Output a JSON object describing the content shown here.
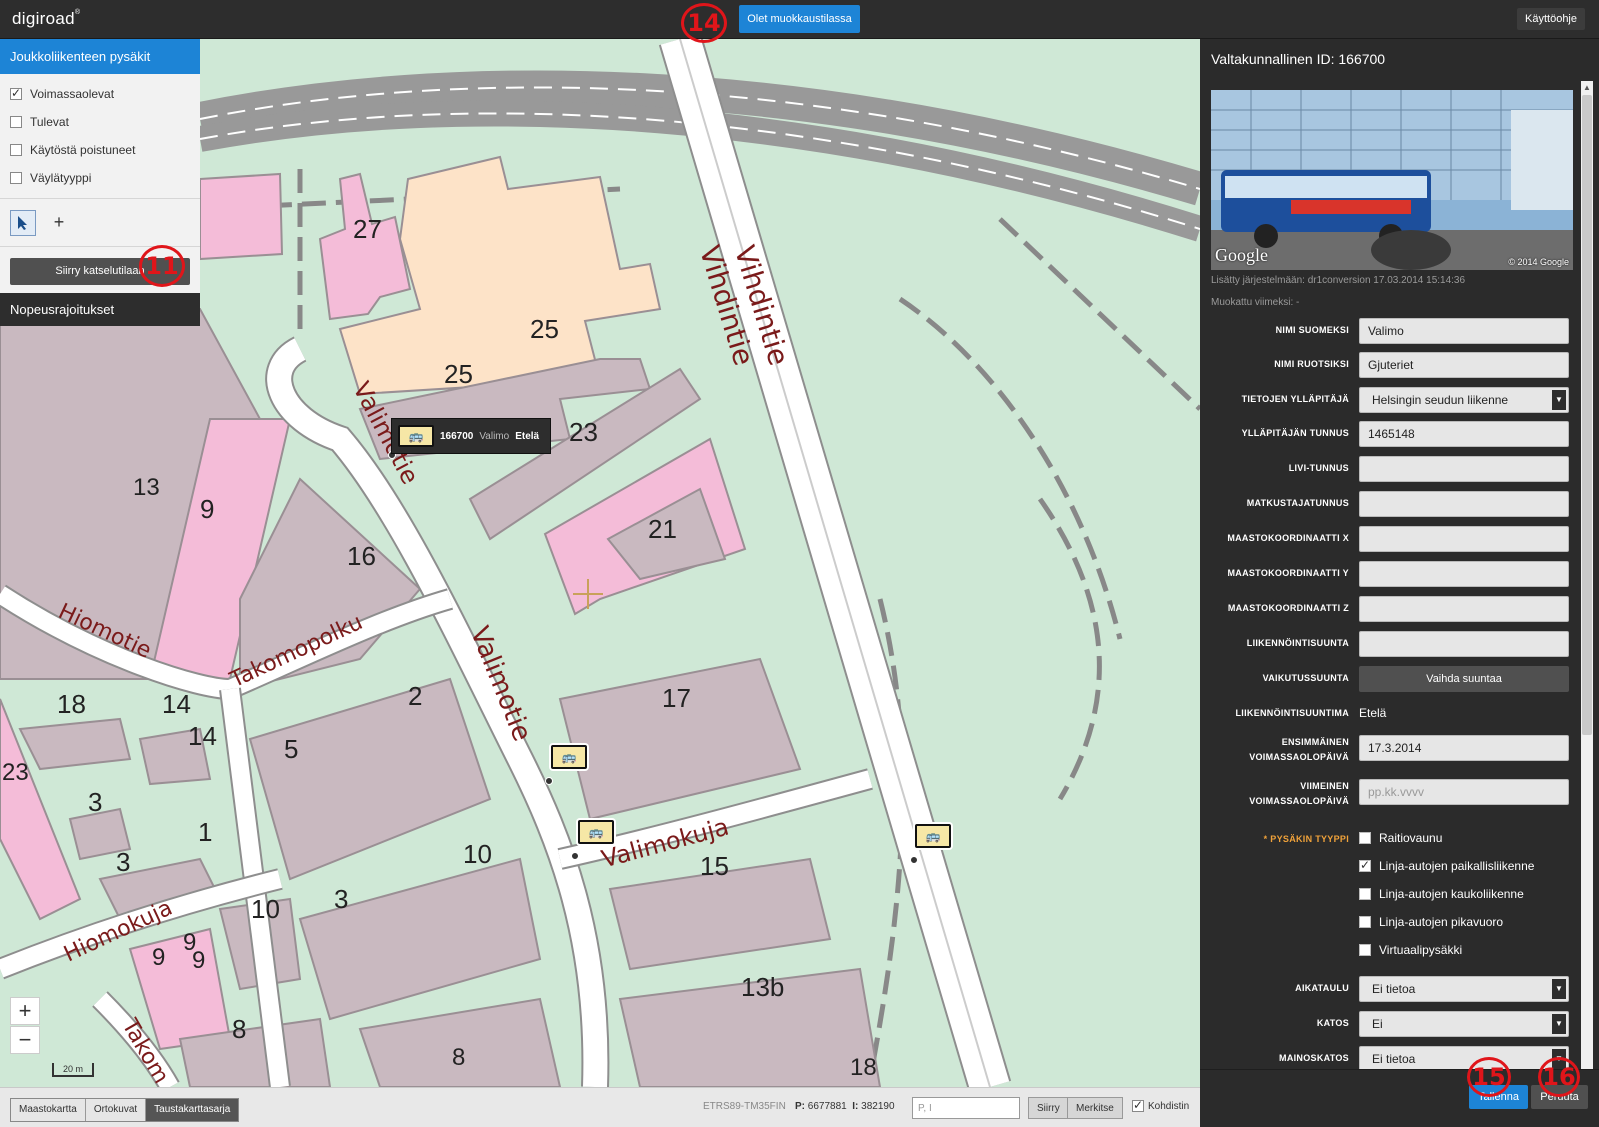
{
  "app": {
    "logo": "digiroad",
    "logo_mark": "®",
    "edit_mode_label": "Olet muokkaustilassa",
    "help_label": "Käyttöohje"
  },
  "callouts": [
    "14",
    "11",
    "15",
    "16"
  ],
  "left_panel": {
    "layer_title": "Joukkoliikenteen pysäkit",
    "layers": [
      {
        "label": "Voimassaolevat",
        "checked": true
      },
      {
        "label": "Tulevat",
        "checked": false
      },
      {
        "label": "Käytöstä poistuneet",
        "checked": false
      },
      {
        "label": "Väylätyyppi",
        "checked": false
      }
    ],
    "view_mode_button": "Siirry katselutilaan",
    "speed_limits_title": "Nopeusrajoitukset"
  },
  "map": {
    "streets": [
      "Vihdintie",
      "Vihdintie",
      "Valimotie",
      "Valimotie",
      "Hiomotie",
      "Takomopolku",
      "Valimokuja",
      "Hiomokuja",
      "Takom"
    ],
    "house_numbers": [
      "27",
      "25",
      "25",
      "23",
      "21",
      "13",
      "9",
      "16",
      "17",
      "18",
      "14",
      "14",
      "5",
      "2",
      "23",
      "3",
      "1",
      "3",
      "10",
      "15",
      "3",
      "10",
      "9",
      "9",
      "9",
      "13b",
      "8",
      "8",
      "18"
    ],
    "popup": {
      "stop_id": "166700",
      "name": "Valimo",
      "direction": "Etelä"
    },
    "zoom_in": "+",
    "zoom_out": "−",
    "scale_label": "20 m"
  },
  "bottom_bar": {
    "basemaps": [
      {
        "label": "Maastokartta",
        "active": false
      },
      {
        "label": "Ortokuvat",
        "active": false
      },
      {
        "label": "Taustakarttasarja",
        "active": true
      }
    ],
    "coord_system": "ETRS89-TM35FIN",
    "coord_p_label": "P:",
    "coord_p": "6677881",
    "coord_i_label": "I:",
    "coord_i": "382190",
    "coord_placeholder": "P, I",
    "move_button": "Siirry",
    "mark_button": "Merkitse",
    "crosshair_label": "Kohdistin",
    "crosshair_checked": true
  },
  "right_panel": {
    "title": "Valtakunnallinen ID: 166700",
    "streetview_logo": "Google",
    "streetview_copyright": "© 2014 Google",
    "added": "Lisätty järjestelmään: dr1conversion 17.03.2014 15:14:36",
    "modified": "Muokattu viimeksi: -",
    "fields": {
      "name_fi": {
        "label": "NIMI SUOMEKSI",
        "value": "Valimo"
      },
      "name_sv": {
        "label": "NIMI RUOTSIKSI",
        "value": "Gjuteriet"
      },
      "maintainer": {
        "label": "TIETOJEN YLLÄPITÄJÄ",
        "value": "Helsingin seudun liikenne"
      },
      "maintainer_id": {
        "label": "YLLÄPITÄJÄN TUNNUS",
        "value": "1465148"
      },
      "livi_id": {
        "label": "LIVI-TUNNUS",
        "value": ""
      },
      "passenger_id": {
        "label": "MATKUSTAJATUNNUS",
        "value": ""
      },
      "coord_x": {
        "label": "MAASTOKOORDINAATTI X",
        "value": ""
      },
      "coord_y": {
        "label": "MAASTOKOORDINAATTI Y",
        "value": ""
      },
      "coord_z": {
        "label": "MAASTOKOORDINAATTI Z",
        "value": ""
      },
      "traffic_direction": {
        "label": "LIIKENNÖINTISUUNTA",
        "value": ""
      },
      "effect_direction": {
        "label": "VAIKUTUSSUUNTA",
        "button": "Vaihda suuntaa"
      },
      "direction_name": {
        "label": "LIIKENNÖINTISUUNTIMA",
        "value": "Etelä"
      },
      "first_valid": {
        "label_1": "ENSIMMÄINEN",
        "label_2": "VOIMASSAOLOPÄIVÄ",
        "value": "17.3.2014"
      },
      "last_valid": {
        "label_1": "VIIMEINEN",
        "label_2": "VOIMASSAOLOPÄIVÄ",
        "placeholder": "pp.kk.vvvv"
      },
      "stop_type": {
        "required_mark": "*",
        "label": "PYSÄKIN TYYPPI",
        "options": [
          {
            "label": "Raitiovaunu",
            "checked": false
          },
          {
            "label": "Linja-autojen paikallisliikenne",
            "checked": true
          },
          {
            "label": "Linja-autojen kaukoliikenne",
            "checked": false
          },
          {
            "label": "Linja-autojen pikavuoro",
            "checked": false
          },
          {
            "label": "Virtuaalipysäkki",
            "checked": false
          }
        ]
      },
      "timetable": {
        "label": "AIKATAULU",
        "value": "Ei tietoa"
      },
      "shelter": {
        "label": "KATOS",
        "value": "Ei"
      },
      "ad_shelter": {
        "label": "MAINOSKATOS",
        "value": "Ei tietoa"
      }
    },
    "save_button": "Tallenna",
    "cancel_button": "Peruuta"
  },
  "colors": {
    "accent_blue": "#1d84d6",
    "map_green": "#cfe8d6",
    "building_grey": "#c9b9c0",
    "building_pink": "#f4bcd8",
    "building_peach": "#fde3c8",
    "road_outline": "#8e8e8e",
    "street_label": "#7a1a1a",
    "callout_red": "#e0151a",
    "required_orange": "#f0a23a"
  },
  "icons": [
    "bus-stop-icon",
    "select-arrow-icon",
    "add-point-icon",
    "chevron-down-icon",
    "crosshair-icon"
  ]
}
